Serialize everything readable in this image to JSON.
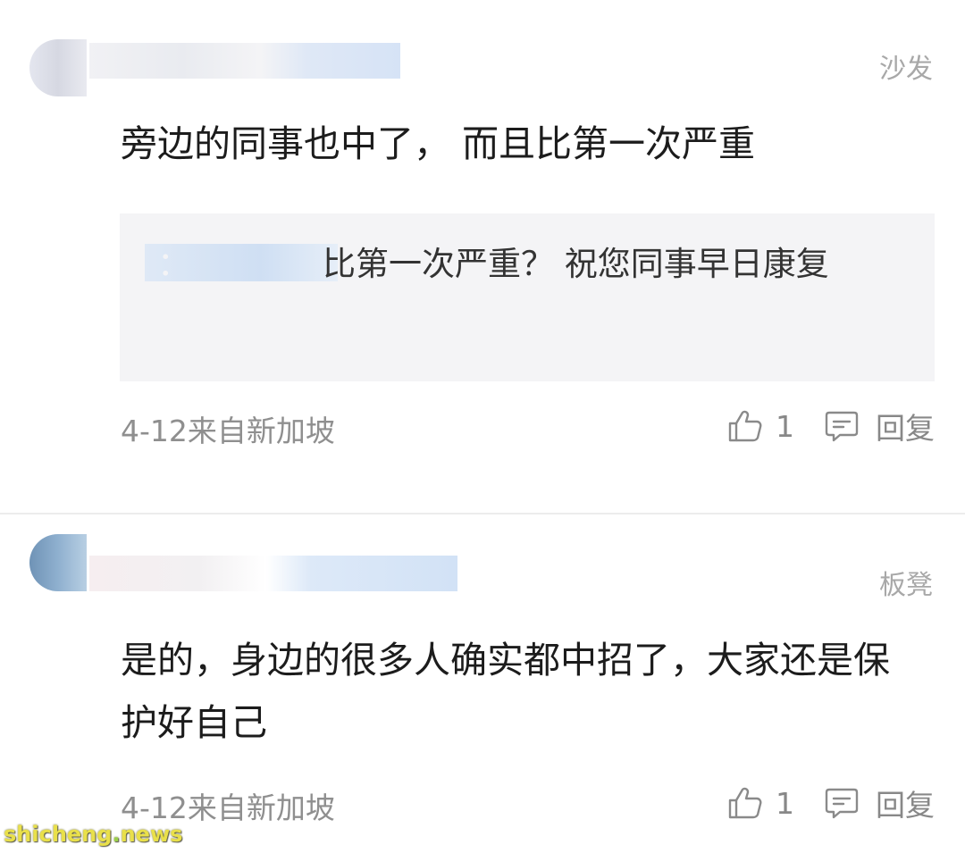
{
  "comments": [
    {
      "floor": "沙发",
      "content": "旁边的同事也中了， 而且比第一次严重",
      "quote": {
        "text": "比第一次严重？ 祝您同事早日康复"
      },
      "meta": "4-12来自新加坡",
      "likes": "1",
      "reply_label": "回复"
    },
    {
      "floor": "板凳",
      "content": "是的，身边的很多人确实都中招了，大家还是保护好自己",
      "meta": "4-12来自新加坡",
      "likes": "1",
      "reply_label": "回复"
    }
  ],
  "watermark": {
    "prefix": "shicheng",
    "dot": ".",
    "suffix": "news"
  },
  "icons": {
    "like": "thumbs-up-outline-icon",
    "reply": "comment-bubble-icon"
  },
  "colors": {
    "text": "#1c1c1c",
    "muted": "#8f8f8f",
    "quote_bg": "#f4f4f6",
    "divider": "#ececec"
  }
}
